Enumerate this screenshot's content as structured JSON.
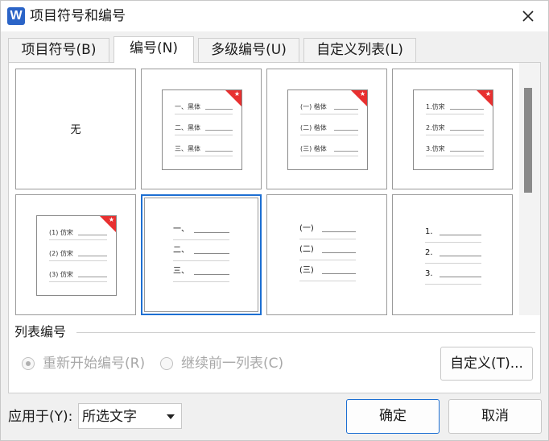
{
  "window": {
    "app_icon_letter": "W",
    "title": "项目符号和编号"
  },
  "tabs": [
    {
      "label": "项目符号(B)"
    },
    {
      "label": "编号(N)"
    },
    {
      "label": "多级编号(U)"
    },
    {
      "label": "自定义列表(L)"
    }
  ],
  "active_tab": "编号(N)",
  "gallery": {
    "none_label": "无",
    "tiles": [
      {
        "kind": "none"
      },
      {
        "kind": "thumb",
        "items": [
          "一、黑体",
          "二、黑体",
          "三、黑体"
        ],
        "badge": true
      },
      {
        "kind": "thumb",
        "items": [
          "(一) 楷体",
          "(二) 楷体",
          "(三) 楷体"
        ],
        "badge": true
      },
      {
        "kind": "thumb",
        "items": [
          "1.仿宋",
          "2.仿宋",
          "3.仿宋"
        ],
        "badge": true
      },
      {
        "kind": "thumb",
        "items": [
          "(1) 仿宋",
          "(2) 仿宋",
          "(3) 仿宋"
        ],
        "badge": true
      },
      {
        "kind": "plain",
        "items": [
          "一、",
          "二、",
          "三、"
        ],
        "selected": true
      },
      {
        "kind": "plain",
        "items": [
          "(一)",
          "(二)",
          "(三)"
        ]
      },
      {
        "kind": "plain",
        "items": [
          "1.",
          "2.",
          "3."
        ]
      }
    ]
  },
  "list_numbering": {
    "section_label": "列表编号",
    "restart_label": "重新开始编号(R)",
    "continue_label": "继续前一列表(C)",
    "restart_selected": true,
    "enabled": false,
    "custom_button": "自定义(T)..."
  },
  "apply_to": {
    "label": "应用于(Y):",
    "value": "所选文字"
  },
  "buttons": {
    "ok": "确定",
    "cancel": "取消"
  },
  "colors": {
    "accent": "#1d6fd2",
    "badge": "#e83030"
  }
}
